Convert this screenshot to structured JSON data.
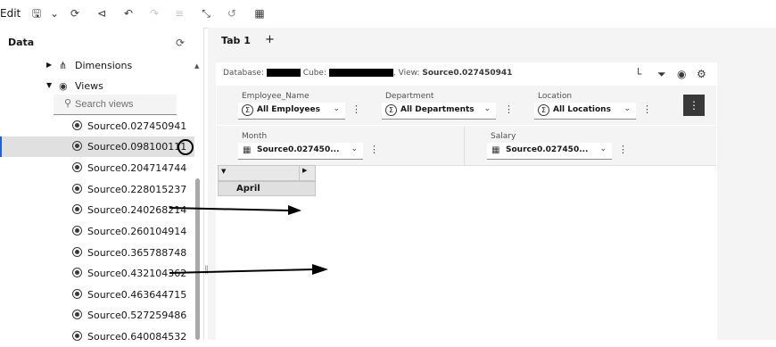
{
  "toolbar": {
    "edit_label": "Edit",
    "icons": [
      "save-icon",
      "chevron-down-icon",
      "refresh-icon",
      "share-icon",
      "undo-icon",
      "redo-icon",
      "filter-icon",
      "expand-icon",
      "history-icon",
      "snapshot-icon"
    ]
  },
  "sidebar": {
    "title": "Data",
    "tree": {
      "dimensions_label": "Dimensions",
      "views_label": "Views"
    },
    "search": {
      "placeholder": "Search views"
    },
    "views": [
      "Source0.027450941",
      "Source0.098100111",
      "Source0.204714744",
      "Source0.228015237",
      "Source0.240268214",
      "Source0.260104914",
      "Source0.365788748",
      "Source0.432104362",
      "Source0.463644715",
      "Source0.527259486",
      "Source0.640084532"
    ],
    "selected_index": 1
  },
  "tabs": {
    "tab1_label": "Tab 1",
    "add_label": "+"
  },
  "view_header": {
    "database_label": "Database:",
    "cube_label": "Cube:",
    "view_label": ", View:",
    "view_name": "Source0.027450941"
  },
  "dimensions": {
    "employee": {
      "label": "Employee_Name",
      "value": "All Employees"
    },
    "department": {
      "label": "Department",
      "value": "All Departments"
    },
    "location": {
      "label": "Location",
      "value": "All Locations"
    },
    "month": {
      "label": "Month",
      "value": "Source0.027450..."
    },
    "salary": {
      "label": "Salary",
      "value": "Source0.027450..."
    }
  },
  "grid": {
    "row_header": "April"
  },
  "colors": {
    "accent": "#0f62fe",
    "selected_bg": "#e0e0e0",
    "panel_bg": "#f4f4f4"
  }
}
